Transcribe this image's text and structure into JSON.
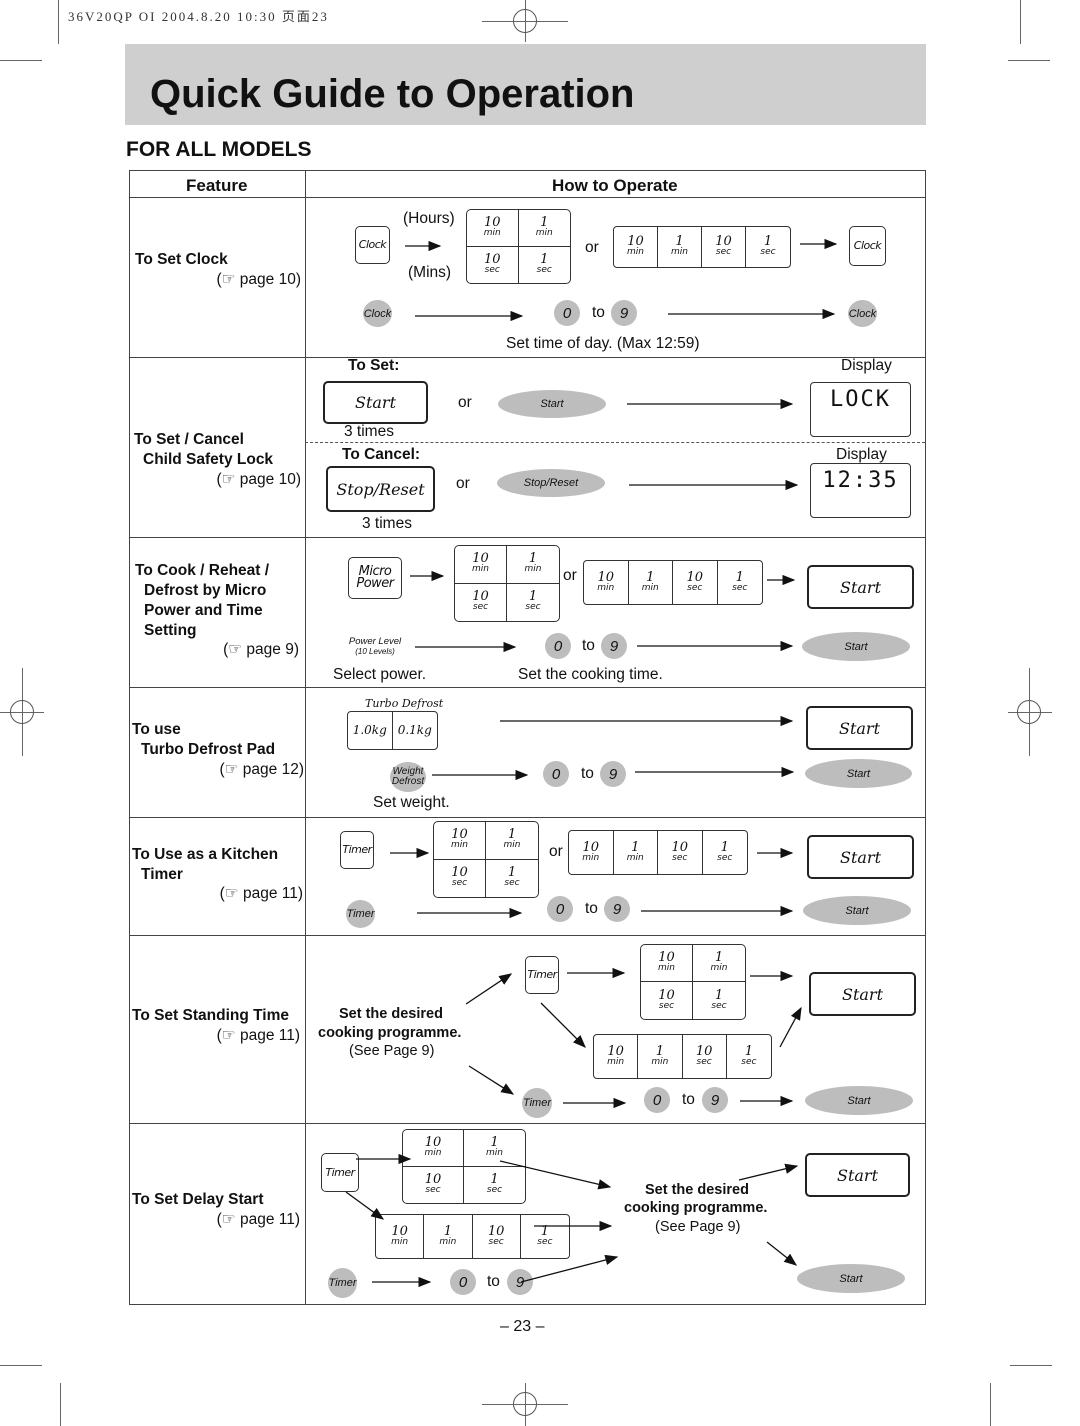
{
  "print_header": "36V20QP OI  2004.8.20 10:30  页面23",
  "title": "Quick Guide to Operation",
  "subtitle": "FOR ALL MODELS",
  "table": {
    "headers": {
      "feature": "Feature",
      "how": "How to Operate"
    },
    "common": {
      "or": "or",
      "to": "to",
      "zero": "0",
      "nine": "9",
      "start": "Start",
      "grid": [
        {
          "n": "10",
          "u": "min"
        },
        {
          "n": "1",
          "u": "min"
        },
        {
          "n": "10",
          "u": "sec"
        },
        {
          "n": "1",
          "u": "sec"
        }
      ]
    },
    "rows": [
      {
        "feature": [
          "To Set Clock"
        ],
        "ref": "(☞ page 10)",
        "labels": {
          "hours": "(Hours)",
          "mins": "(Mins)",
          "clock": "Clock",
          "note": "Set time of day. (Max 12:59)"
        }
      },
      {
        "feature": [
          "To Set / Cancel",
          "Child Safety Lock"
        ],
        "ref": "(☞ page 10)",
        "labels": {
          "to_set": "To Set:",
          "to_cancel": "To Cancel:",
          "display": "Display",
          "times": "3 times",
          "stop_reset": "Stop/Reset",
          "display_lock": "LOCK",
          "display_time": "12:35"
        }
      },
      {
        "feature": [
          "To Cook / Reheat /",
          "Defrost by Micro",
          "Power and Time",
          "Setting"
        ],
        "ref": "(☞ page 9)",
        "labels": {
          "micro_power": "Micro Power",
          "power_level": "Power Level",
          "levels": "(10 Levels)",
          "select_power": "Select power.",
          "set_time": "Set the cooking time."
        }
      },
      {
        "feature": [
          "To use",
          "Turbo Defrost Pad"
        ],
        "ref": "(☞ page 12)",
        "labels": {
          "turbo_defrost": "Turbo Defrost",
          "kg1": "1.0kg",
          "kg2": "0.1kg",
          "weight_defrost": "Weight Defrost",
          "set_weight": "Set weight."
        }
      },
      {
        "feature": [
          "To Use as a Kitchen",
          "Timer"
        ],
        "ref": "(☞ page 11)",
        "labels": {
          "timer": "Timer"
        }
      },
      {
        "feature": [
          "To Set Standing Time"
        ],
        "ref": "(☞ page 11)",
        "labels": {
          "timer": "Timer",
          "desired": "Set the desired",
          "programme": "cooking programme.",
          "see": "(See Page 9)"
        }
      },
      {
        "feature": [
          "To Set Delay Start"
        ],
        "ref": "(☞ page 11)",
        "labels": {
          "timer": "Timer",
          "desired": "Set the desired",
          "programme": "cooking programme.",
          "see": "(See Page 9)"
        }
      }
    ]
  },
  "page_number": "– 23 –"
}
